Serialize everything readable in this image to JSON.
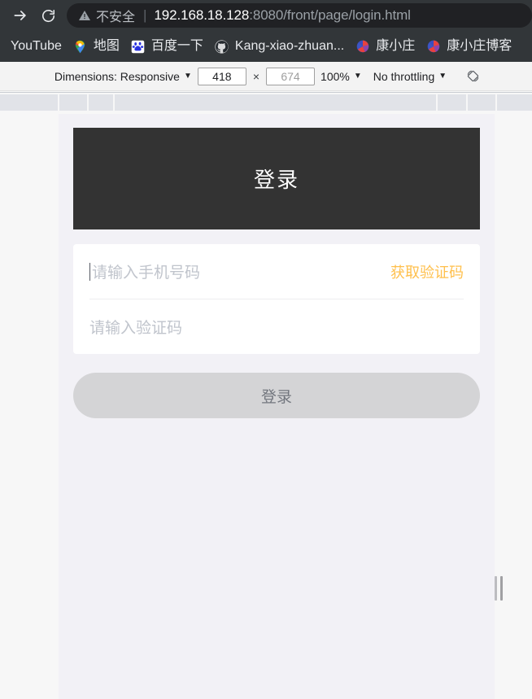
{
  "browser": {
    "nav": {
      "forward_icon": "forward-arrow-icon",
      "reload_icon": "reload-icon"
    },
    "omnibox": {
      "warning_icon": "warning-triangle-icon",
      "security_label": "不安全",
      "separator": "|",
      "url_host": "192.168.18.128",
      "url_path": ":8080/front/page/login.html"
    },
    "bookmarks": [
      {
        "label": "YouTube",
        "icon": ""
      },
      {
        "label": "地图",
        "icon": "google-maps-pin-icon"
      },
      {
        "label": "百度一下",
        "icon": "baidu-paw-icon"
      },
      {
        "label": "Kang-xiao-zhuan...",
        "icon": "github-icon"
      },
      {
        "label": "康小庄",
        "icon": "blog-favicon"
      },
      {
        "label": "康小庄博客",
        "icon": "blog-favicon"
      }
    ]
  },
  "devtools": {
    "dimensions_label": "Dimensions: Responsive",
    "width_value": "418",
    "height_value": "674",
    "zoom_label": "100%",
    "throttling_label": "No throttling",
    "rotate_icon": "rotate-device-icon",
    "caret": "▼",
    "times_symbol": "×"
  },
  "page": {
    "header_title": "登录",
    "phone_placeholder": "请输入手机号码",
    "get_code_label": "获取验证码",
    "code_placeholder": "请输入验证码",
    "submit_label": "登录"
  },
  "colors": {
    "chrome_bg": "#323639",
    "omnibox_bg": "#202124",
    "header_dark": "#333333",
    "accent_orange": "#ffc04d",
    "page_bg": "#f2f1f6",
    "button_disabled": "#d4d4d6"
  }
}
